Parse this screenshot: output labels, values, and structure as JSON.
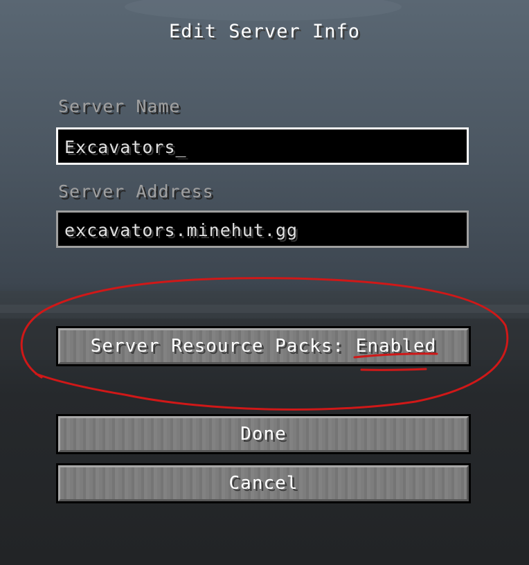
{
  "screen": {
    "title": "Edit Server Info"
  },
  "form": {
    "server_name_label": "Server Name",
    "server_name_value": "Excavators_",
    "server_address_label": "Server Address",
    "server_address_value": "excavators.minehut.gg"
  },
  "buttons": {
    "resource_packs_prefix": "Server Resource Packs: ",
    "resource_packs_value": "Enabled",
    "done_label": "Done",
    "cancel_label": "Cancel"
  },
  "colors": {
    "annotation_red": "#d01818",
    "label_gray": "#a0a0a0",
    "field_border_focused": "#ffffff"
  }
}
